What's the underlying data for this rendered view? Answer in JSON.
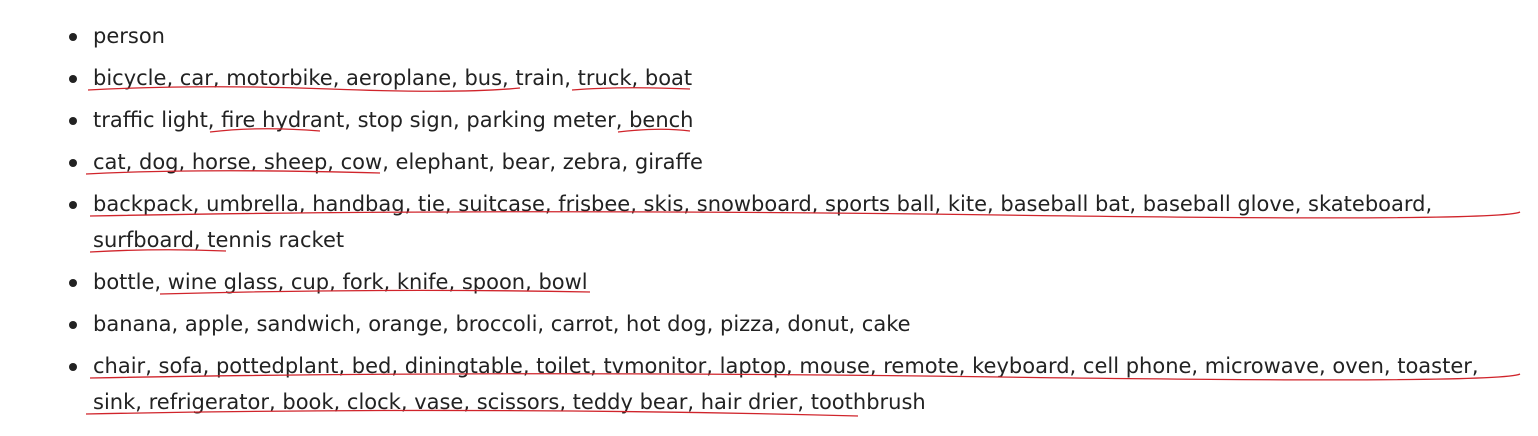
{
  "list": {
    "items": [
      "person",
      "bicycle, car, motorbike, aeroplane, bus, train, truck, boat",
      "traffic light, fire hydrant, stop sign, parking meter, bench",
      "cat, dog, horse, sheep, cow, elephant, bear, zebra, giraffe",
      "backpack, umbrella, handbag, tie, suitcase, frisbee, skis, snowboard, sports ball, kite, baseball bat, baseball glove, skateboard, surfboard, tennis racket",
      "bottle, wine glass, cup, fork, knife, spoon, bowl",
      "banana, apple, sandwich, orange, broccoli, carrot, hot dog, pizza, donut, cake",
      "chair, sofa, pottedplant, bed, diningtable, toilet, tvmonitor, laptop, mouse, remote, keyboard, cell phone, microwave, oven, toaster, sink, refrigerator, book, clock, vase, scissors, teddy bear, hair drier, toothbrush"
    ]
  },
  "colors": {
    "text": "#222222",
    "spellcheck_underline": "#d0242b"
  }
}
